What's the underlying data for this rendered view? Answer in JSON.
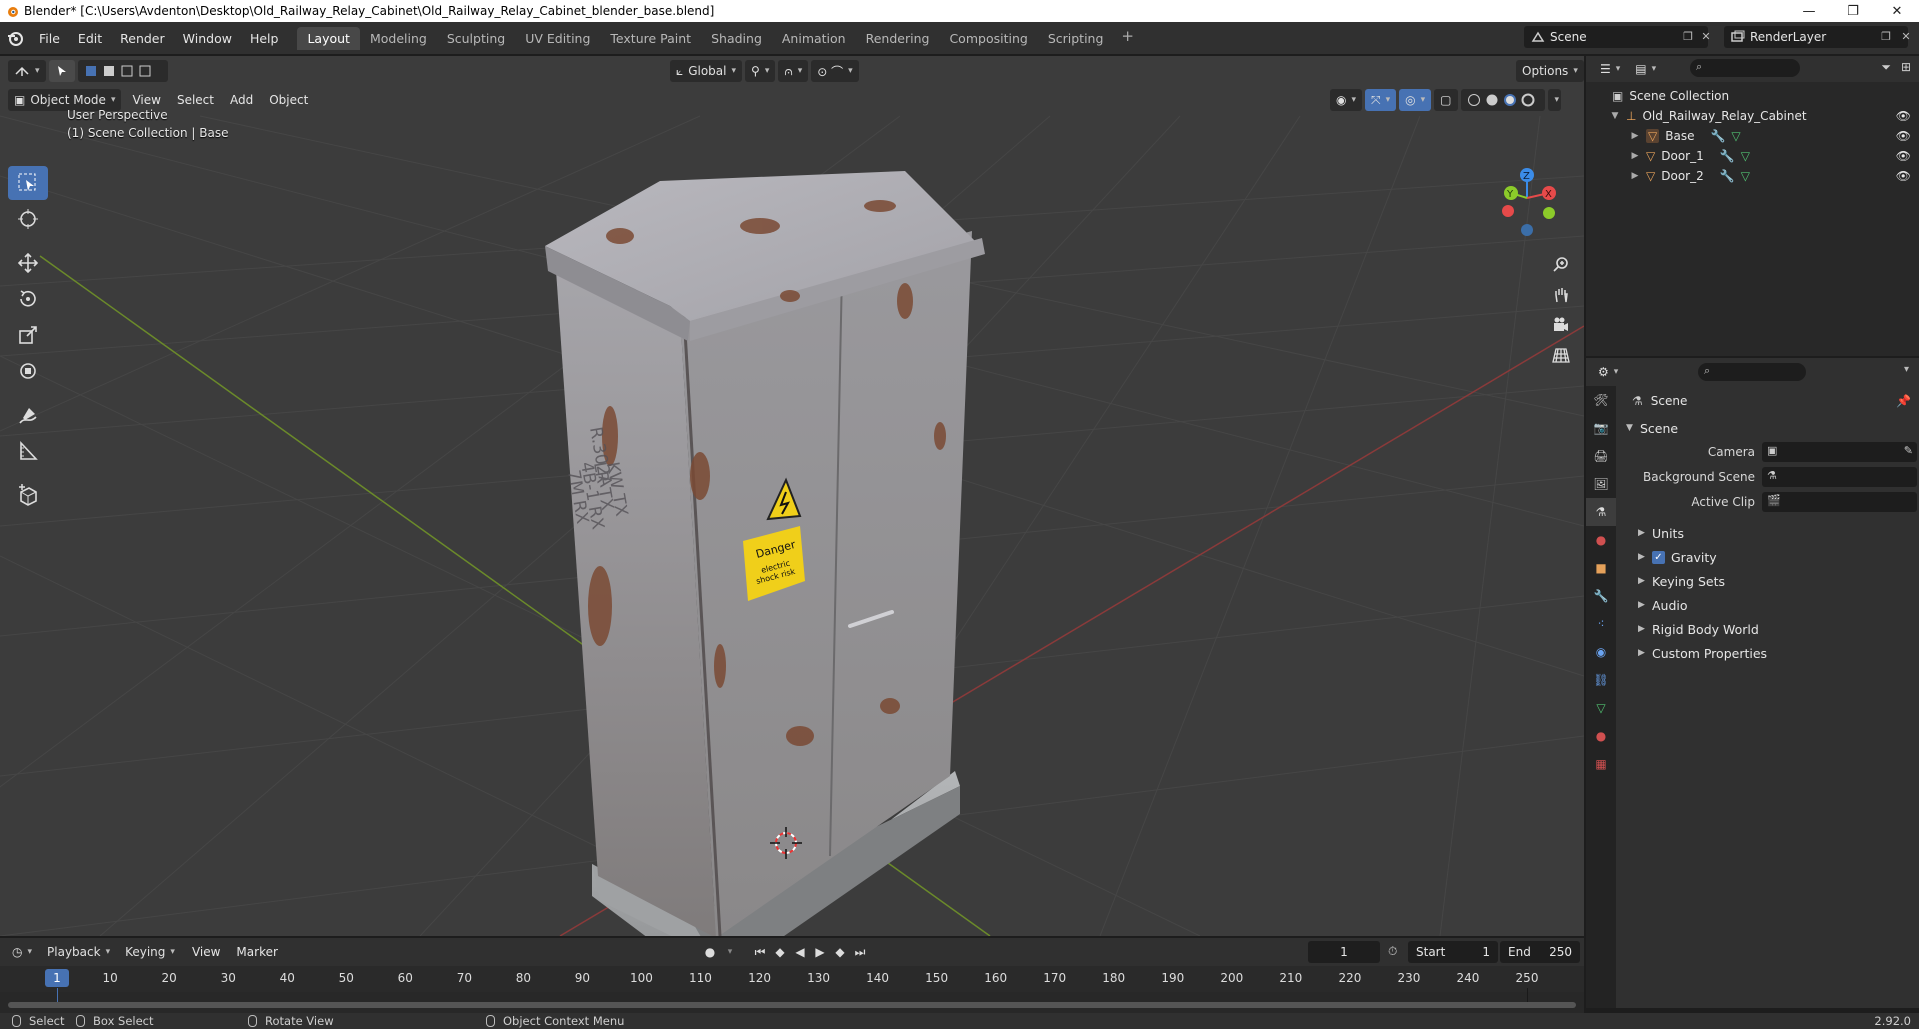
{
  "window": {
    "title": "Blender* [C:\\Users\\Avdenton\\Desktop\\Old_Railway_Relay_Cabinet\\Old_Railway_Relay_Cabinet_blender_base.blend]",
    "controls": [
      "—",
      "❐",
      "✕"
    ]
  },
  "menu": [
    "File",
    "Edit",
    "Render",
    "Window",
    "Help"
  ],
  "workspaces": [
    "Layout",
    "Modeling",
    "Sculpting",
    "UV Editing",
    "Texture Paint",
    "Shading",
    "Animation",
    "Rendering",
    "Compositing",
    "Scripting"
  ],
  "workspace_active": "Layout",
  "scene_name": "Scene",
  "view_layer": "RenderLayer",
  "viewport": {
    "mode": "Object Mode",
    "menus": [
      "View",
      "Select",
      "Add",
      "Object"
    ],
    "transform_orientation": "Global",
    "options_label": "Options",
    "overlay_line1": "User Perspective",
    "overlay_line2": "(1) Scene Collection | Base",
    "gizmo_axes": [
      "X",
      "Y",
      "Z"
    ]
  },
  "outliner": {
    "root": "Scene Collection",
    "collection": "Old_Railway_Relay_Cabinet",
    "objects": [
      "Base",
      "Door_1",
      "Door_2"
    ]
  },
  "properties": {
    "header": "Scene",
    "panel": "Scene",
    "fields": [
      "Camera",
      "Background Scene",
      "Active Clip"
    ],
    "sections": [
      "Units",
      "Gravity",
      "Keying Sets",
      "Audio",
      "Rigid Body World",
      "Custom Properties"
    ],
    "gravity_checked": true
  },
  "timeline": {
    "menus": [
      "Playback",
      "Keying",
      "View",
      "Marker"
    ],
    "current_frame": "1",
    "start_label": "Start",
    "start": "1",
    "end_label": "End",
    "end": "250",
    "ticks": [
      "1",
      "10",
      "20",
      "30",
      "40",
      "50",
      "60",
      "70",
      "80",
      "90",
      "100",
      "110",
      "120",
      "130",
      "140",
      "150",
      "160",
      "170",
      "180",
      "190",
      "200",
      "210",
      "220",
      "230",
      "240",
      "250"
    ]
  },
  "statusbar": {
    "select": "Select",
    "box_select": "Box Select",
    "rotate": "Rotate View",
    "context_menu": "Object Context Menu",
    "version": "2.92.0"
  },
  "cabinet_decal": {
    "line1": "Danger",
    "line2": "electric",
    "line3": "shock risk",
    "stencil": [
      "R.302A",
      "KW TX",
      "LR TX",
      "4B-1 RX",
      "7M RX"
    ]
  },
  "colors": {
    "accent": "#4772b3",
    "grid_x": "#8a3a3a",
    "grid_y": "#6b8a2a",
    "axis_x": "#e64a4a",
    "axis_y": "#8ccb2a",
    "axis_z": "#3b8ce8"
  }
}
